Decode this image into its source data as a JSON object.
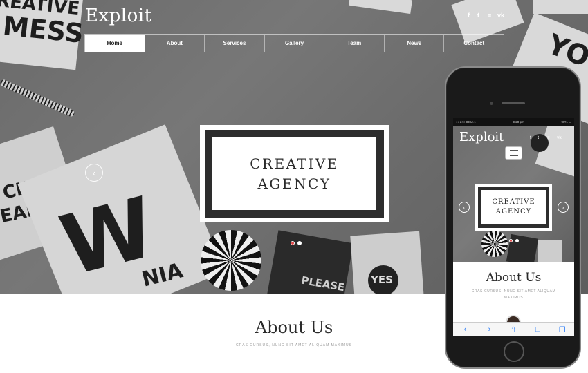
{
  "header": {
    "logo": "Exploit",
    "social_icons": [
      {
        "name": "facebook-icon",
        "glyph": "f"
      },
      {
        "name": "twitter-icon",
        "glyph": "t"
      },
      {
        "name": "rss-icon",
        "glyph": "≡"
      },
      {
        "name": "vk-icon",
        "glyph": "vk"
      }
    ]
  },
  "nav": {
    "items": [
      "Home",
      "About",
      "Services",
      "Gallery",
      "Team",
      "News",
      "Contact"
    ],
    "active": "Home"
  },
  "hero": {
    "badge_line1": "CREATIVE",
    "badge_line2": "AGENCY",
    "prev_arrow": "‹",
    "slides": 2,
    "active_slide": 1
  },
  "about": {
    "title": "About Us",
    "subtitle": "CRAS CURSUS, NUNC SIT AMET ALIQUAM MAXIMUS"
  },
  "phone": {
    "status": {
      "carrier": "●●●○○ IDEA ≈",
      "time": "9:20 pm",
      "battery": "90% ▭"
    },
    "logo": "Exploit",
    "badge_line1": "CREATIVE",
    "badge_line2": "AGENCY",
    "prev_arrow": "‹",
    "next_arrow": "›",
    "about_title": "About Us",
    "about_subtitle": "CRAS CURSUS, NUNC SIT AMET ALIQUAM MAXIMUS",
    "toolbar": {
      "back": "‹",
      "forward": "›",
      "share": "⇧",
      "bookmarks": "□",
      "tabs": "❐"
    }
  },
  "background_text": {
    "top_left": "REATIVE",
    "top_left_2": "MESS",
    "left_1": "CK",
    "left_2": "EAH!",
    "big_w": "W",
    "bottom": "NIA",
    "please": "PLEASE",
    "yes": "YES",
    "right_you": "YOU"
  },
  "colors": {
    "accent_dot": "#e04848",
    "badge_dark": "#2d2d2d",
    "ios_blue": "#2d7df6"
  }
}
